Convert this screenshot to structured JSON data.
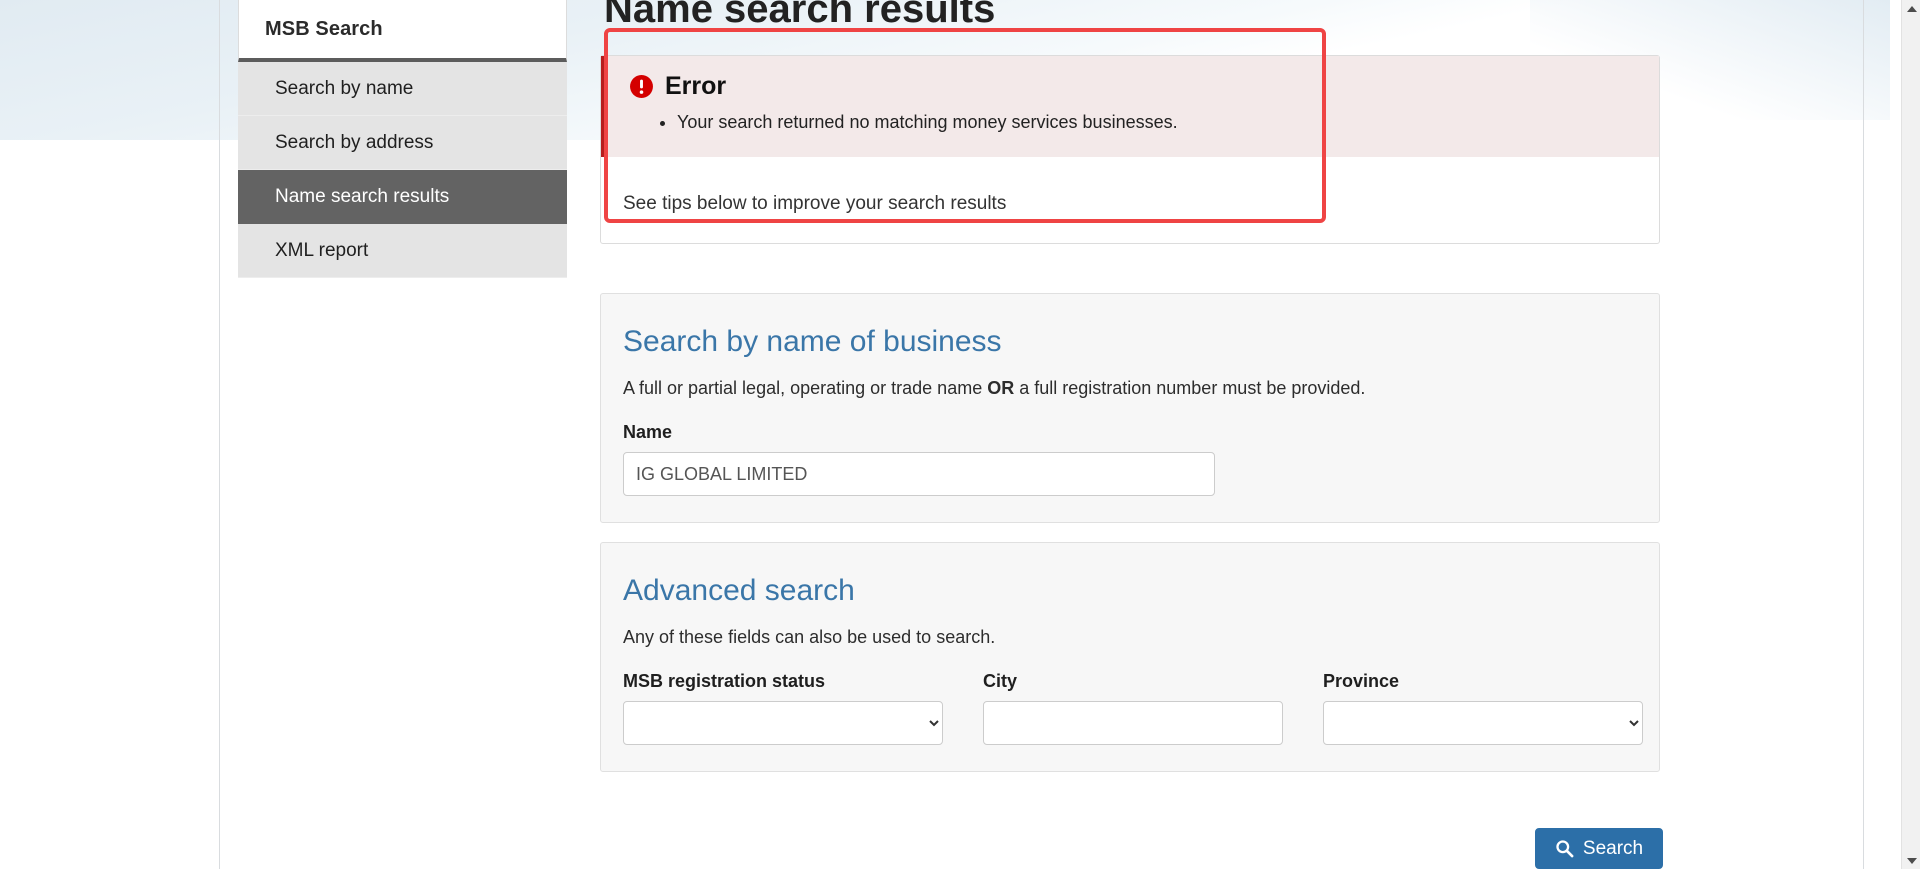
{
  "sidebar": {
    "header_title": "MSB Search",
    "items": [
      {
        "label": "Search by name",
        "active": false
      },
      {
        "label": "Search by address",
        "active": false
      },
      {
        "label": "Name search results",
        "active": true
      },
      {
        "label": "XML report",
        "active": false
      }
    ]
  },
  "main": {
    "page_title": "Name search results",
    "error": {
      "icon": "error-exclamation-icon",
      "title": "Error",
      "messages": [
        "Your search returned no matching money services businesses."
      ]
    },
    "tips_text": "See tips below to improve your search results",
    "name_search": {
      "title": "Search by name of business",
      "desc_before": "A full or partial legal, operating or trade name ",
      "desc_strong": "OR",
      "desc_after": " a full registration number must be provided.",
      "name_label": "Name",
      "name_value": "IG GLOBAL LIMITED",
      "name_placeholder": "IG GLOBAL LIMITED"
    },
    "advanced_search": {
      "title": "Advanced search",
      "desc": "Any of these fields can also be used to search.",
      "status_label": "MSB registration status",
      "status_value": "",
      "status_options": [
        ""
      ],
      "city_label": "City",
      "city_value": "",
      "city_placeholder": "",
      "province_label": "Province",
      "province_value": "",
      "province_options": [
        ""
      ]
    },
    "search_button": {
      "label": "Search",
      "icon": "search-magnifier-icon"
    }
  },
  "colors": {
    "accent_link": "#3a76a8",
    "button_primary": "#2c6fa8",
    "error_red": "#b71d1d",
    "error_bg": "#f3e9e9",
    "annotation_red": "#ef4444",
    "sidebar_active_bg": "#636363",
    "sidebar_item_bg": "#e4e4e4"
  },
  "scrollbar": {
    "up_arrow": "scroll-up-arrow-icon",
    "down_arrow": "scroll-down-arrow-icon"
  }
}
